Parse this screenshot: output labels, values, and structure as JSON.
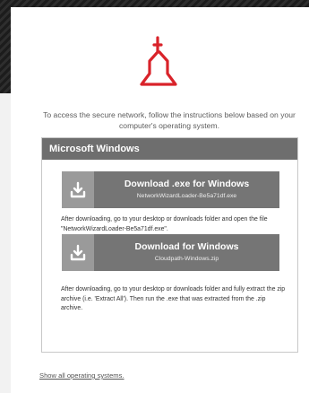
{
  "intro_text": "To access the secure network, follow the instructions below based on your computer's operating system.",
  "panel": {
    "title": "Microsoft Windows",
    "downloads": [
      {
        "label": "Download .exe for Windows",
        "filename": "NetworkWizardLoader-Be5a71df.exe",
        "icon": "download-icon"
      },
      {
        "label": "Download for Windows",
        "filename": "Cloudpath-Windows.zip",
        "icon": "download-icon"
      }
    ],
    "notes": [
      "After downloading, go to your desktop or downloads folder and open the file \"NetworkWizardLoader-Be5a71df.exe\".",
      "After downloading, go to your desktop or downloads folder and fully extract the zip archive (i.e. 'Extract All'). Then run the .exe that was extracted from the .zip archive."
    ]
  },
  "show_all_link": "Show all operating systems.",
  "colors": {
    "logo_red": "#d9232a",
    "header_gray": "#6e6e6e",
    "button_gray": "#757575",
    "icon_box_gray": "#9a9a9a"
  }
}
